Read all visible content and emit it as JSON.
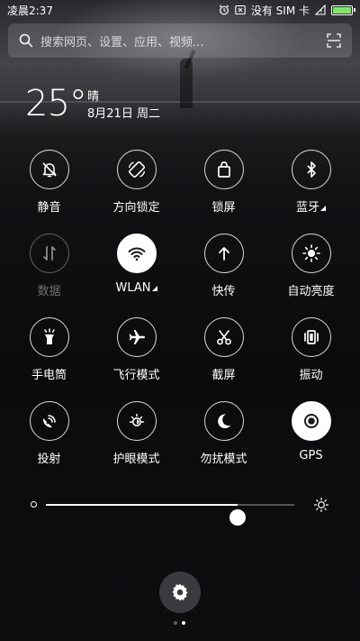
{
  "status_bar": {
    "time": "凌晨2:37",
    "carrier": "没有 SIM 卡",
    "battery_level": 1.0,
    "icons": [
      "alarm-icon",
      "notification-x-icon",
      "sim-absent-icon",
      "battery-icon"
    ]
  },
  "search": {
    "placeholder": "搜索网页、设置、应用、视频..."
  },
  "weather": {
    "temperature": "25°",
    "condition": "晴",
    "date": "8月21日 周二"
  },
  "toggles": [
    {
      "label": "静音",
      "icon": "bell-slash-icon",
      "state": "off"
    },
    {
      "label": "方向锁定",
      "icon": "rotation-lock-icon",
      "state": "off"
    },
    {
      "label": "锁屏",
      "icon": "lock-bag-icon",
      "state": "off"
    },
    {
      "label": "蓝牙",
      "icon": "bluetooth-icon",
      "state": "off",
      "has_menu": true
    },
    {
      "label": "数据",
      "icon": "data-arrows-icon",
      "state": "disabled"
    },
    {
      "label": "WLAN",
      "icon": "wifi-icon",
      "state": "on",
      "has_menu": true
    },
    {
      "label": "快传",
      "icon": "up-arrow-icon",
      "state": "off"
    },
    {
      "label": "自动亮度",
      "icon": "sun-icon",
      "state": "off"
    },
    {
      "label": "手电筒",
      "icon": "flashlight-icon",
      "state": "off"
    },
    {
      "label": "飞行模式",
      "icon": "airplane-icon",
      "state": "off"
    },
    {
      "label": "截屏",
      "icon": "scissors-icon",
      "state": "off"
    },
    {
      "label": "振动",
      "icon": "vibrate-icon",
      "state": "off"
    },
    {
      "label": "投射",
      "icon": "cast-icon",
      "state": "off"
    },
    {
      "label": "护眼模式",
      "icon": "eye-care-icon",
      "state": "off"
    },
    {
      "label": "勿扰模式",
      "icon": "moon-icon",
      "state": "off"
    },
    {
      "label": "GPS",
      "icon": "gps-icon",
      "state": "on"
    }
  ],
  "brightness": {
    "level": 0.77
  },
  "pager": {
    "page_count": 2,
    "current_page": 2
  },
  "colors": {
    "background": "#0b0b0d",
    "battery": "#7ee46a",
    "active_toggle": "#ffffff"
  }
}
